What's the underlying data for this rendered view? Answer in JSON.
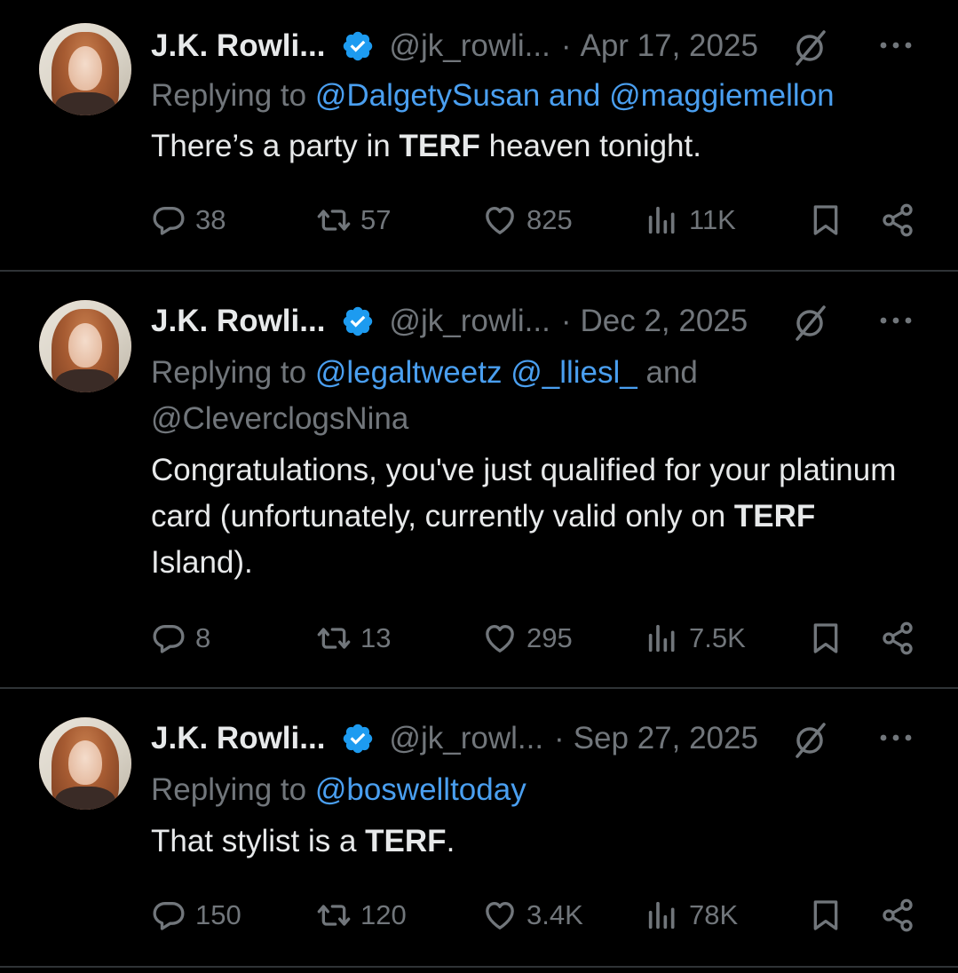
{
  "colors": {
    "background": "#000000",
    "text": "#e7e9ea",
    "muted": "#71767b",
    "mention": "#4a9ff0",
    "verified": "#1d9bf0",
    "divider": "#2f3336"
  },
  "icons": {
    "reply": "reply-bubble-icon",
    "retweet": "retweet-icon",
    "like": "heart-icon",
    "views": "views-bars-icon",
    "bookmark": "bookmark-icon",
    "share": "share-icon",
    "grok": "grok-icon",
    "more": "more-dots-icon",
    "verified": "verified-badge-icon"
  },
  "tweets": [
    {
      "author": {
        "name": "J.K. Rowli...",
        "handle": "@jk_rowli..."
      },
      "separator": "·",
      "date": "Apr 17, 2025",
      "reply": {
        "prefix": "Replying to ",
        "mention_1": "@DalgetySusan",
        "joiner": " and ",
        "mention_2": "@maggiemellon"
      },
      "text": {
        "part_1": "There’s a party in ",
        "bold": "TERF",
        "part_2": " heaven tonight."
      },
      "stats": {
        "replies": "38",
        "retweets": "57",
        "likes": "825",
        "views": "11K"
      }
    },
    {
      "author": {
        "name": "J.K. Rowli...",
        "handle": "@jk_rowli..."
      },
      "separator": "·",
      "date": "Dec 2, 2025",
      "reply": {
        "prefix": "Replying to ",
        "mention_1": "@legaltweetz",
        "mention_2": "@_lliesl_",
        "joiner": " and",
        "mention_3": "@CleverclogsNina"
      },
      "text": {
        "part_1": "Congratulations, you've just qualified for your platinum card (unfortunately, currently valid only on ",
        "bold": "TERF",
        "part_2": " Island)."
      },
      "stats": {
        "replies": "8",
        "retweets": "13",
        "likes": "295",
        "views": "7.5K"
      }
    },
    {
      "author": {
        "name": "J.K. Rowli...",
        "handle": "@jk_rowl..."
      },
      "separator": "·",
      "date": "Sep 27, 2025",
      "reply": {
        "prefix": "Replying to ",
        "mention_1": "@boswelltoday"
      },
      "text": {
        "part_1": "That stylist is a ",
        "bold": "TERF",
        "part_2": "."
      },
      "stats": {
        "replies": "150",
        "retweets": "120",
        "likes": "3.4K",
        "views": "78K"
      }
    }
  ]
}
